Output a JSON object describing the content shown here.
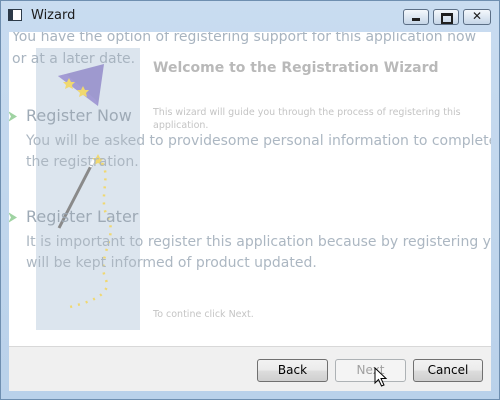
{
  "window": {
    "title": "Wizard",
    "controls": {
      "minimize": "minimize",
      "maximize": "maximize",
      "close": "close"
    }
  },
  "wizard": {
    "heading": "Welcome to the Registration Wizard",
    "intro": "This wizard will guide you through the process of registering this application.",
    "continue_hint": "To contine click Next."
  },
  "overlay": {
    "intro": "You have the option of registering support for this application now or at a later date.",
    "options": [
      {
        "title": "Register Now",
        "description": "You will be asked to providesome personal information to complete the registration."
      },
      {
        "title": "Register Later",
        "description": "It is important to register this application because by registering you will be kept informed of product updated."
      }
    ]
  },
  "buttons": {
    "back": "Back",
    "next": "Next",
    "cancel": "Cancel"
  },
  "colors": {
    "title_bar": "#c9dcf0",
    "option_arrow": "#4caf50",
    "banner": "#dce5ee"
  }
}
